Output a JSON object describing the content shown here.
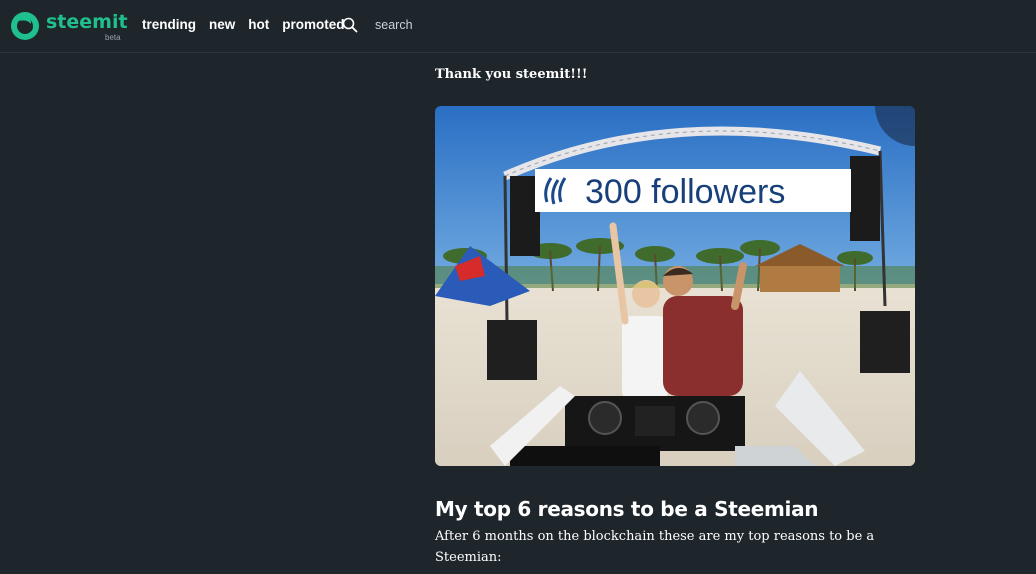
{
  "header": {
    "logo_text": "steemit",
    "logo_badge": "beta",
    "nav": [
      "trending",
      "new",
      "hot",
      "promoted"
    ],
    "search_placeholder": "search"
  },
  "post": {
    "intro": "Thank you steemit!!!",
    "image_caption_text": "300 followers",
    "title": "My top 6 reasons to be a Steemian",
    "body": "After 6 months on the blockchain these are my top reasons to be a Steemian:"
  },
  "colors": {
    "background": "#1e252b",
    "brand": "#1fbf8f"
  }
}
